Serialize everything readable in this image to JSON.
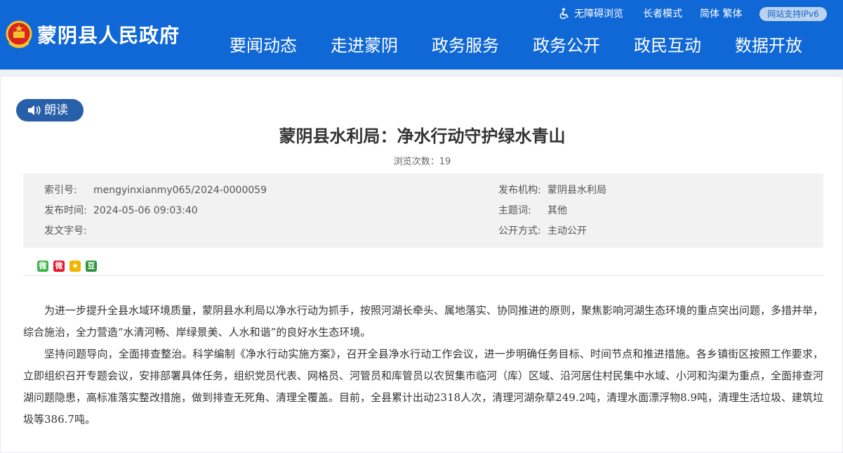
{
  "header": {
    "site_title": "蒙阴县人民政府",
    "utility": {
      "accessibility": "无障碍浏览",
      "elder_mode": "长者模式",
      "lang_simplified": "简体",
      "lang_traditional": "繁体",
      "ipv6": "网站支持IPv6"
    },
    "nav": [
      "要闻动态",
      "走进蒙阴",
      "政务服务",
      "政务公开",
      "政民互动",
      "数据开放"
    ]
  },
  "article": {
    "read_aloud": "朗读",
    "title": "蒙阴县水利局：净水行动守护绿水青山",
    "views_label": "浏览次数：",
    "views_count": "19",
    "meta": {
      "index_label": "索引号:",
      "index_value": "mengyinxianmy065/2024-0000059",
      "publisher_label": "发布机构:",
      "publisher_value": "蒙阴县水利局",
      "date_label": "发布时间:",
      "date_value": "2024-05-06 09:03:40",
      "topic_label": "主题词:",
      "topic_value": "其他",
      "doc_no_label": "发文字号:",
      "doc_no_value": "",
      "open_label": "公开方式:",
      "open_value": "主动公开"
    },
    "share": [
      {
        "name": "wechat-share-icon",
        "glyph": "微",
        "color": "#3bb54a"
      },
      {
        "name": "weibo-share-icon",
        "glyph": "微",
        "color": "#e6162d"
      },
      {
        "name": "qzone-share-icon",
        "glyph": "★",
        "color": "#f5b400"
      },
      {
        "name": "douban-share-icon",
        "glyph": "豆",
        "color": "#2e963d"
      }
    ],
    "paragraphs": [
      "为进一步提升全县水域环境质量，蒙阴县水利局以净水行动为抓手，按照河湖长牵头、属地落实、协同推进的原则，聚焦影响河湖生态环境的重点突出问题，多措并举，综合施治，全力营造“水清河畅、岸绿景美、人水和谐”的良好水生态环境。",
      "坚持问题导向，全面排查整治。科学编制《净水行动实施方案》，召开全县净水行动工作会议，进一步明确任务目标、时间节点和推进措施。各乡镇街区按照工作要求，立即组织召开专题会议，安排部署具体任务，组织党员代表、网格员、河管员和库管员以农贸集市临河（库）区域、沿河居住村民集中水域、小河和沟渠为重点，全面排查河湖问题隐患，高标准落实整改措施，做到排查无死角、清理全覆盖。目前，全县累计出动2318人次，清理河湖杂草249.2吨，清理水面漂浮物8.9吨，清理生活垃圾、建筑垃圾等386.7吨。"
    ]
  },
  "colors": {
    "header_bg": "#1068d6",
    "read_button_bg": "#275fa9",
    "meta_bg": "#f2f2f2"
  }
}
